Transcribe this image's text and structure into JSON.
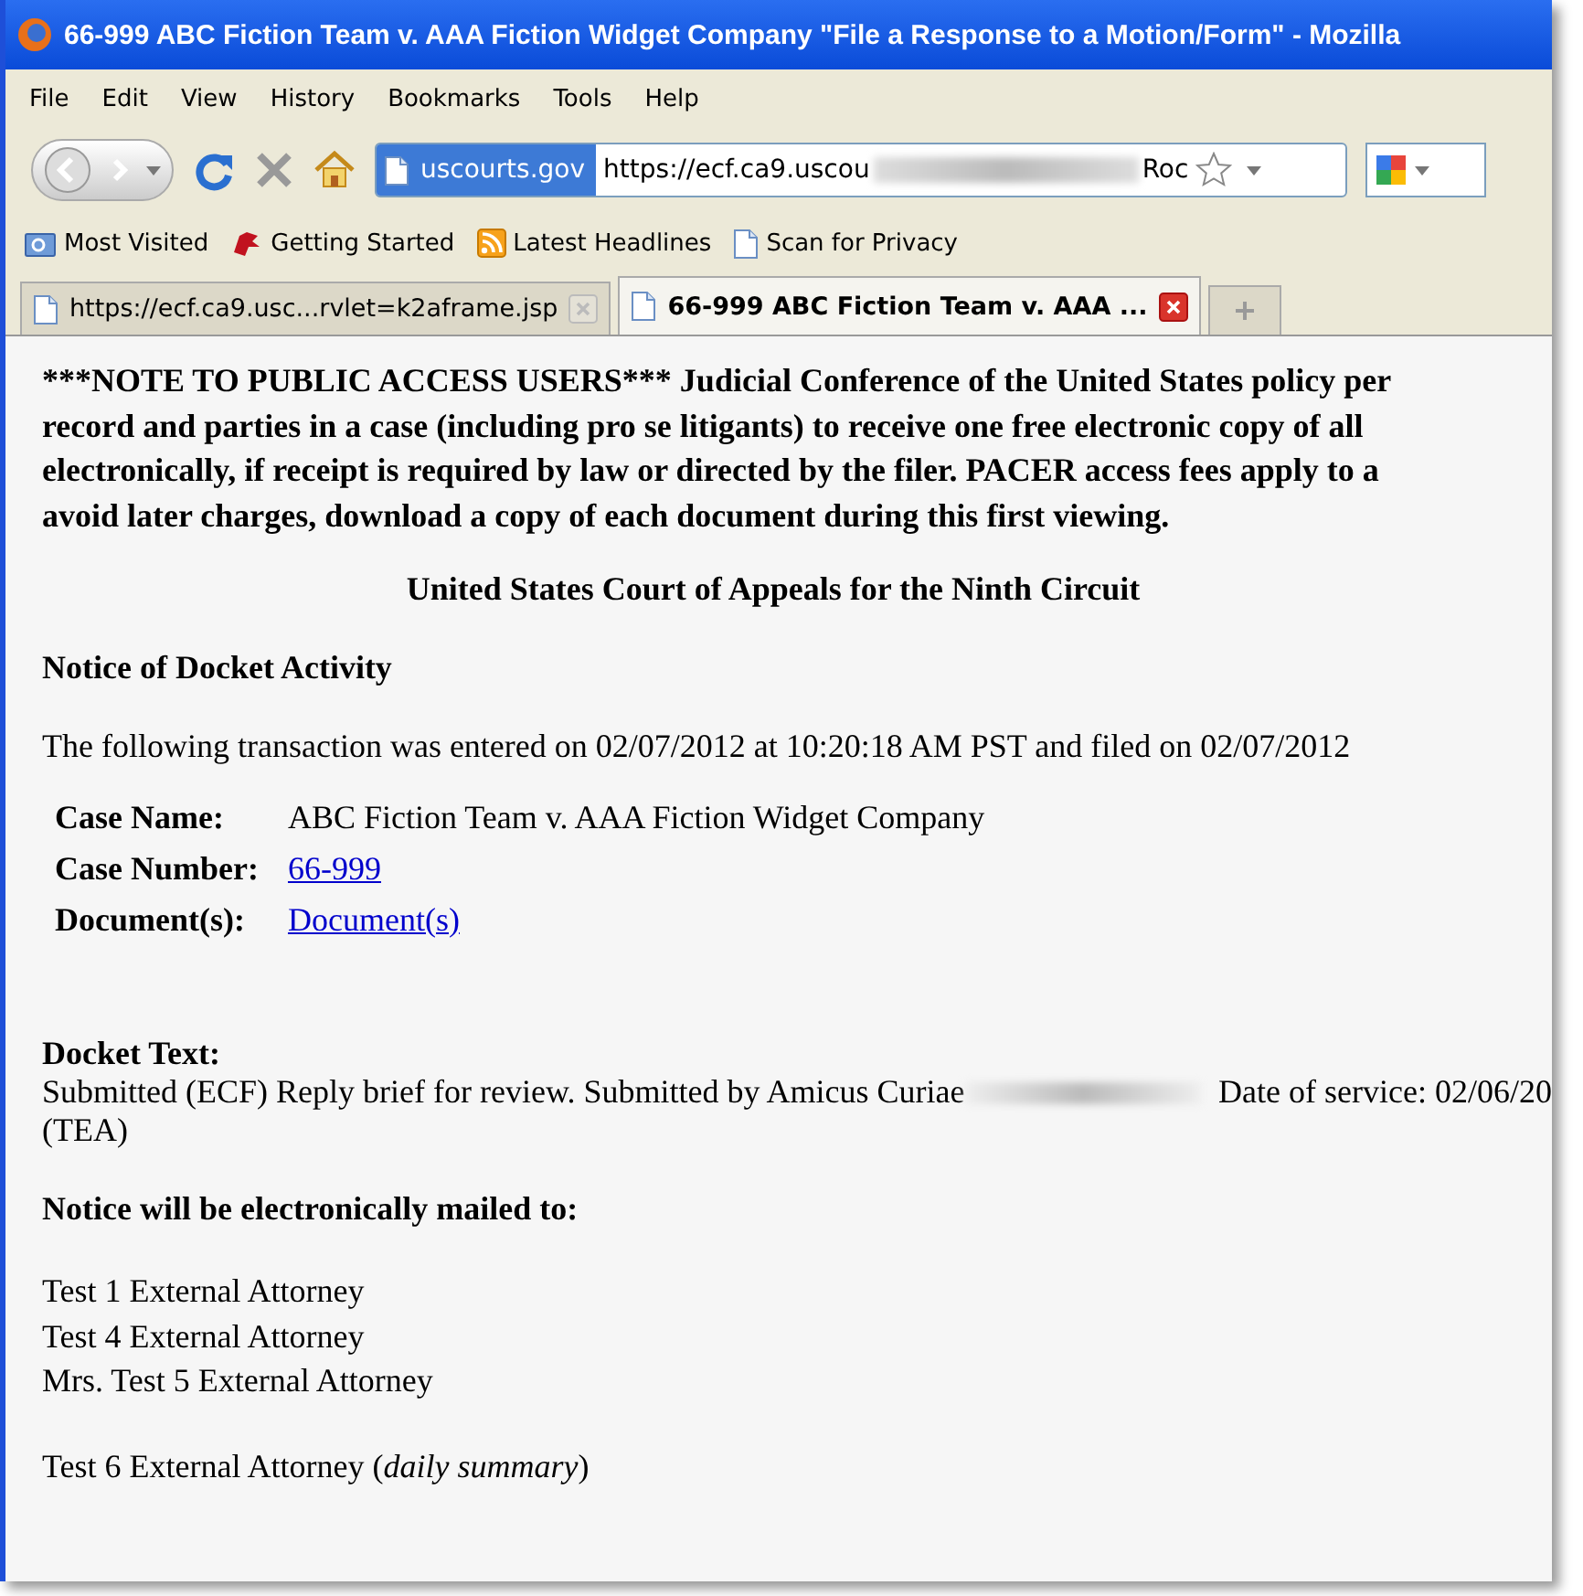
{
  "window": {
    "title": "66-999 ABC Fiction Team v. AAA Fiction Widget Company \"File a Response to a Motion/Form\" - Mozilla"
  },
  "menu": [
    "File",
    "Edit",
    "View",
    "History",
    "Bookmarks",
    "Tools",
    "Help"
  ],
  "address_bar": {
    "identity": "uscourts.gov",
    "url": "https://ecf.ca9.uscou",
    "url_tail": "Roc"
  },
  "bookmarks": [
    {
      "label": "Most Visited",
      "kind": "folder"
    },
    {
      "label": "Getting Started",
      "kind": "starter"
    },
    {
      "label": "Latest Headlines",
      "kind": "feed"
    },
    {
      "label": "Scan for Privacy",
      "kind": "page"
    }
  ],
  "tabs": [
    {
      "label": "https://ecf.ca9.usc...rvlet=k2aframe.jsp",
      "selected": false
    },
    {
      "label": "66-999 ABC Fiction Team v. AAA ...",
      "selected": true
    }
  ],
  "content": {
    "notice_lines": [
      "***NOTE TO PUBLIC ACCESS USERS*** Judicial Conference of the United States policy per",
      "record and parties in a case (including pro se litigants) to receive one free electronic copy of all",
      "electronically, if receipt is required by law or directed by the filer. PACER access fees apply to a",
      "avoid later charges, download a copy of each document during this first viewing."
    ],
    "court": "United States Court of Appeals for the Ninth Circuit",
    "section_title": "Notice of Docket Activity",
    "transaction": "The following transaction was entered on 02/07/2012 at 10:20:18 AM PST and filed on 02/07/2012",
    "fields": [
      {
        "label": "Case Name:",
        "value": "ABC Fiction Team v. AAA Fiction Widget Company",
        "link": false
      },
      {
        "label": "Case Number:",
        "value": "66-999",
        "link": true
      },
      {
        "label": "Document(s):",
        "value": "Document(s)",
        "link": true
      }
    ],
    "docket_label": "Docket Text:",
    "docket_line": "Submitted (ECF) Reply brief for review. Submitted by Amicus Curiae",
    "docket_service": "Date of service: 02/06/20",
    "docket_end": "(TEA)",
    "mailed_heading": "Notice will be electronically mailed to:",
    "recipient_groups": [
      [
        "Test 1 External Attorney",
        "Test 4 External Attorney",
        "Mrs. Test 5 External Attorney"
      ],
      [
        "Test 6 External Attorney (*daily summary*)"
      ]
    ]
  }
}
